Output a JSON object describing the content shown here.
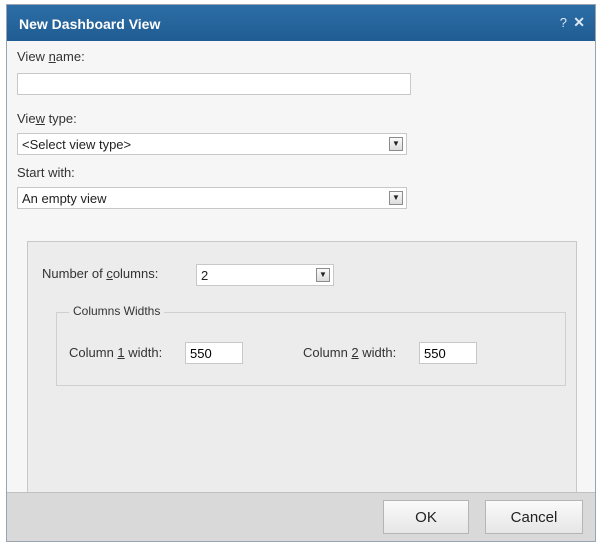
{
  "dialog": {
    "title": "New Dashboard View",
    "help_icon": "?",
    "close_icon": "✕"
  },
  "form": {
    "view_name": {
      "label_pre": "View ",
      "label_key": "n",
      "label_post": "ame:",
      "value": ""
    },
    "view_type": {
      "label_pre": "Vie",
      "label_key": "w",
      "label_post": " type:",
      "selected": "<Select view type>"
    },
    "start_with": {
      "label": "Start with:",
      "selected": "An empty view"
    }
  },
  "columns_panel": {
    "num_columns": {
      "label_pre": "Number of ",
      "label_key": "c",
      "label_post": "olumns:",
      "selected": "2"
    },
    "widths_legend": "Columns Widths",
    "col1": {
      "label_pre": "Column ",
      "label_key": "1",
      "label_post": " width:",
      "value": "550"
    },
    "col2": {
      "label_pre": "Column ",
      "label_key": "2",
      "label_post": " width:",
      "value": "550"
    }
  },
  "buttons": {
    "ok": "OK",
    "cancel": "Cancel"
  },
  "icons": {
    "dropdown_arrow": "▼"
  }
}
